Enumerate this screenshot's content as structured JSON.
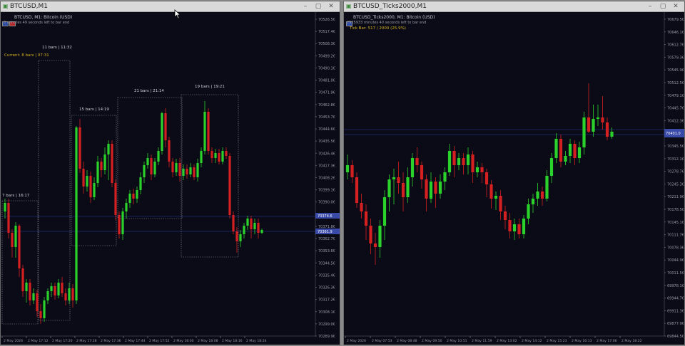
{
  "left": {
    "window_title": "BTCUSD,M1",
    "chart_title": "BTCUSD, M1:  Bitcoin (USD)",
    "countdown": "0 minutes 49 seconds left to bar end",
    "current_label": "Current: 8 bars | 07:31",
    "boxes": [
      {
        "label": "7 bars | 16:17",
        "bars": 7
      },
      {
        "label": "11 bars | 11:32",
        "bars": 11
      },
      {
        "label": "15 bars | 14:19",
        "bars": 15
      },
      {
        "label": "21 bars | 21:14",
        "bars": 21
      },
      {
        "label": "19 bars | 19:21",
        "bars": 19
      }
    ],
    "price_axis": [
      "70526.5€",
      "70517.4€",
      "70508.3€",
      "70499.2€",
      "70490.1€",
      "70481.0€",
      "70471.9€",
      "70462.8€",
      "70453.7€",
      "70444.6€",
      "70435.5€",
      "70426.4€",
      "70417.3€",
      "70408.2€",
      "70399.1€",
      "70390.0€",
      "70380.9€",
      "70371.8€",
      "70362.7€",
      "70353.6€",
      "70344.5€",
      "70335.4€",
      "70326.3€",
      "70317.2€",
      "70308.1€",
      "70299.0€",
      "70289.9€"
    ],
    "time_axis": [
      "2 May 2026",
      "2 May 17:12",
      "2 May 17:20",
      "2 May 17:28",
      "2 May 17:36",
      "2 May 17:44",
      "2 May 17:52",
      "2 May 18:00",
      "2 May 18:08",
      "2 May 18:16",
      "2 May 18:24"
    ],
    "price_tag_1": "70374.6",
    "price_tag_2": "70361.9"
  },
  "right": {
    "window_title": "BTCUSD_Ticks2000,M1",
    "chart_title": "BTCUSD_Ticks2000, M1:  Bitcoin (USD)",
    "countdown": "2925933 minutes 40 seconds left to bar end",
    "tick_label": "Tick Bar: 517 / 2000 (25.9%)",
    "price_axis": [
      "70679.5€",
      "70646.1€",
      "70612.7€",
      "70579.3€",
      "70545.9€",
      "70512.5€",
      "70479.1€",
      "70445.7€",
      "70412.3€",
      "70378.9€",
      "70345.5€",
      "70312.1€",
      "70278.7€",
      "70245.3€",
      "70211.9€",
      "70178.5€",
      "70145.1€",
      "70111.7€",
      "70078.3€",
      "70044.9€",
      "70011.5€",
      "69978.1€",
      "69944.7€",
      "69911.3€",
      "69877.9€",
      "69844.5€"
    ],
    "time_axis": [
      "2 May 2026",
      "2 May 07:53",
      "2 May 08:48",
      "2 May 09:50",
      "2 May 10:51",
      "2 May 11:59",
      "2 May 13:02",
      "2 May 14:12",
      "2 May 15:23",
      "2 May 16:13",
      "2 May 17:06",
      "2 May 18:22"
    ],
    "price_tag": "70401.0"
  },
  "colors": {
    "bull": "#2bd22b",
    "bear": "#d42020",
    "bg": "#0a0b16",
    "grid_box": "#8a8a98",
    "axis_text": "#9a9aa8",
    "gold": "#d8b020",
    "price_tag": "#3a4aa8"
  },
  "icons": {
    "title_icon": "chart-window-icon",
    "minimize": "minimize-icon",
    "maximize": "maximize-icon",
    "close": "close-icon"
  }
}
